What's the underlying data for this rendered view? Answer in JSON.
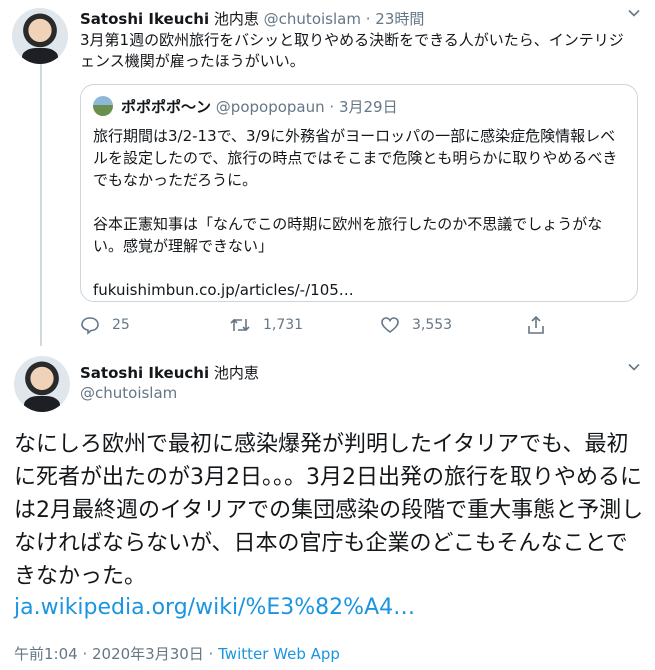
{
  "tweet1": {
    "name": "Satoshi Ikeuchi",
    "name_jp": "池内恵",
    "handle": "@chutoislam",
    "dot": "·",
    "time": "23時間",
    "text": "3月第1週の欧州旅行をバシッと取りやめる決断をできる人がいたら、インテリジェンス機関が雇ったほうがいい。",
    "quote": {
      "name": "ポポポポ〜ン",
      "handle": "@popopopaun",
      "date": "3月29日",
      "para1": "旅行期間は3/2-13で、3/9に外務省がヨーロッパの一部に感染症危険情報レベルを設定したので、旅行の時点ではそこまで危険とも明らかに取りやめるべきでもなかっただろうに。",
      "para2": "谷本正憲知事は「なんでこの時期に欧州を旅行したのか不思議でしょうがない。感覚が理解できない」",
      "link": "fukuishimbun.co.jp/articles/-/105…"
    },
    "actions": {
      "replies": "25",
      "retweets": "1,731",
      "likes": "3,553"
    }
  },
  "tweet2": {
    "name": "Satoshi Ikeuchi",
    "name_jp": "池内恵",
    "handle": "@chutoislam",
    "text": "なにしろ欧州で最初に感染爆発が判明したイタリアでも、最初に死者が出たのが3月2日。。。3月2日出発の旅行を取りやめるには2月最終週のイタリアでの集団感染の段階で重大事態と予測しなければならないが、日本の官庁も企業のどこもそんなことできなかった。",
    "link": "ja.wikipedia.org/wiki/%E3%82%A4…",
    "timestamp": "午前1:04 · 2020年3月30日 ·",
    "app": "Twitter Web App"
  },
  "colors": {
    "text": "#14171a",
    "secondary": "#657786",
    "link": "#1b95e0",
    "border": "#ccd6dd"
  }
}
